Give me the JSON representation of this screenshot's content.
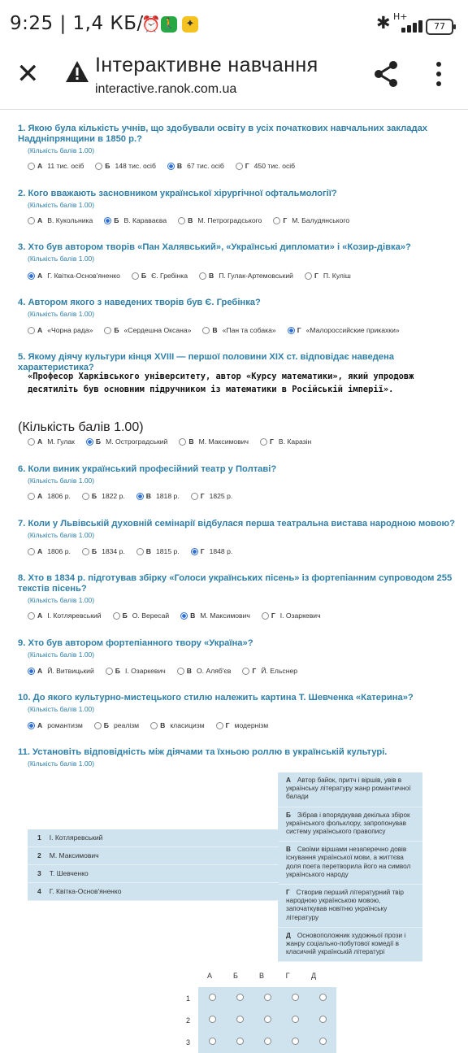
{
  "status": {
    "time": "9:25",
    "speed": "1,4 КБ/с",
    "signal_label": "H+",
    "battery": "77"
  },
  "appbar": {
    "title": "Інтерактивне навчання",
    "url": "interactive.ranok.com.ua"
  },
  "questions": [
    {
      "title": "1. Якою була кількість учнів, що здобували освіту в усіх початкових навчальних закладах Наддніпрянщини в 1850 р.?",
      "score": "(Кількість балів 1.00)",
      "options": [
        {
          "letter": "А",
          "text": "11 тис. осіб",
          "selected": false
        },
        {
          "letter": "Б",
          "text": "148 тис. осіб",
          "selected": false
        },
        {
          "letter": "В",
          "text": "67 тис. осіб",
          "selected": true
        },
        {
          "letter": "Г",
          "text": "450 тис. осіб",
          "selected": false
        }
      ]
    },
    {
      "title": "2. Кого вважають засновником української хірургічної офтальмології?",
      "score": "(Кількість балів 1.00)",
      "options": [
        {
          "letter": "А",
          "text": "В. Кукольника",
          "selected": false
        },
        {
          "letter": "Б",
          "text": "В. Караваєва",
          "selected": true
        },
        {
          "letter": "В",
          "text": "М. Петроградського",
          "selected": false
        },
        {
          "letter": "Г",
          "text": "М. Балудянського",
          "selected": false
        }
      ]
    },
    {
      "title": "3. Хто був автором творів «Пан Халявський», «Українські дипломати» і «Козир-дівка»?",
      "score": "(Кількість балів 1.00)",
      "options": [
        {
          "letter": "А",
          "text": "Г. Квітка-Основ'яненко",
          "selected": true
        },
        {
          "letter": "Б",
          "text": "Є. Гребінка",
          "selected": false
        },
        {
          "letter": "В",
          "text": "П. Гулак-Артемовський",
          "selected": false
        },
        {
          "letter": "Г",
          "text": "П. Куліш",
          "selected": false
        }
      ]
    },
    {
      "title": "4. Автором якого з наведених творів був Є. Гребінка?",
      "score": "(Кількість балів 1.00)",
      "options": [
        {
          "letter": "А",
          "text": "«Чорна рада»",
          "selected": false
        },
        {
          "letter": "Б",
          "text": "«Сердешна Оксана»",
          "selected": false
        },
        {
          "letter": "В",
          "text": "«Пан та собака»",
          "selected": false
        },
        {
          "letter": "Г",
          "text": "«Малороссийские прикахки»",
          "selected": true
        }
      ]
    },
    {
      "title": "5. Якому діячу культури кінця XVIII — першої половини XIX ст. відповідає наведена характеристика?",
      "score": "(Кількість балів 1.00)",
      "quote": "«Професор Харківського університету, автор «Курсу математики», який упродовж десятиліть був основним підручником із математики в Російській імперії».",
      "options": [
        {
          "letter": "А",
          "text": "М. Гулак",
          "selected": false
        },
        {
          "letter": "Б",
          "text": "М. Остроградський",
          "selected": true
        },
        {
          "letter": "В",
          "text": "М. Максимович",
          "selected": false
        },
        {
          "letter": "Г",
          "text": "В. Каразін",
          "selected": false
        }
      ]
    },
    {
      "title": "6. Коли виник український професійний театр у Полтаві?",
      "score": "(Кількість балів 1.00)",
      "options": [
        {
          "letter": "А",
          "text": "1806 р.",
          "selected": false
        },
        {
          "letter": "Б",
          "text": "1822 р.",
          "selected": false
        },
        {
          "letter": "В",
          "text": "1818 р.",
          "selected": true
        },
        {
          "letter": "Г",
          "text": "1825 р.",
          "selected": false
        }
      ]
    },
    {
      "title": "7. Коли у Львівській духовній семінарії відбулася перша театральна вистава народною мовою?",
      "score": "(Кількість балів 1.00)",
      "options": [
        {
          "letter": "А",
          "text": "1806 р.",
          "selected": false
        },
        {
          "letter": "Б",
          "text": "1834 р.",
          "selected": false
        },
        {
          "letter": "В",
          "text": "1815 р.",
          "selected": false
        },
        {
          "letter": "Г",
          "text": "1848 р.",
          "selected": true
        }
      ]
    },
    {
      "title": "8. Хто в 1834 р. підготував збірку «Голоси українських пісень» із фортепіанним супроводом 255 текстів пісень?",
      "score": "(Кількість балів 1.00)",
      "options": [
        {
          "letter": "А",
          "text": "І. Котляревський",
          "selected": false
        },
        {
          "letter": "Б",
          "text": "О. Вересай",
          "selected": false
        },
        {
          "letter": "В",
          "text": "М. Максимович",
          "selected": true
        },
        {
          "letter": "Г",
          "text": "І. Озаркевич",
          "selected": false
        }
      ]
    },
    {
      "title": "9. Хто був автором фортепіанного твору «Україна»?",
      "score": "(Кількість балів 1.00)",
      "options": [
        {
          "letter": "А",
          "text": "Й. Витвицький",
          "selected": true
        },
        {
          "letter": "Б",
          "text": "І. Озаркевич",
          "selected": false
        },
        {
          "letter": "В",
          "text": "О. Аляб'єв",
          "selected": false
        },
        {
          "letter": "Г",
          "text": "Й. Ельснер",
          "selected": false
        }
      ]
    },
    {
      "title": "10. До якого культурно-мистецького стилю належить картина Т. Шевченка «Катерина»?",
      "score": "(Кількість балів 1.00)",
      "options": [
        {
          "letter": "А",
          "text": "романтизм",
          "selected": true
        },
        {
          "letter": "Б",
          "text": "реалізм",
          "selected": false
        },
        {
          "letter": "В",
          "text": "класицизм",
          "selected": false
        },
        {
          "letter": "Г",
          "text": "модернізм",
          "selected": false
        }
      ]
    },
    {
      "title": "11. Установіть відповідність між діячами та їхньою роллю в українській культурі.",
      "score": "(Кількість балів 1.00)"
    }
  ],
  "matching": {
    "left": [
      {
        "num": "1",
        "text": "І. Котляревський"
      },
      {
        "num": "2",
        "text": "М. Максимович"
      },
      {
        "num": "3",
        "text": "Т. Шевченко"
      },
      {
        "num": "4",
        "text": "Г. Квітка-Основ'яненко"
      }
    ],
    "right": [
      {
        "letter": "А",
        "text": "Автор байок, притч і віршів, увів в українську літературу жанр романтичної балади"
      },
      {
        "letter": "Б",
        "text": "Зібрав і впорядкував декілька збірок українського фольклору, запропонував систему українського правопису"
      },
      {
        "letter": "В",
        "text": "Своїми віршами незаперечно довів існування української мови, а життєва доля поета перетворила його на символ українського народу"
      },
      {
        "letter": "Г",
        "text": "Створив перший літературний твір народною українською мовою, започаткував новітню українську літературу"
      },
      {
        "letter": "Д",
        "text": "Основоположник художньої прози і жанру соціально-побутової комедії в класичній українській літературі"
      }
    ],
    "grid_cols": [
      "А",
      "Б",
      "В",
      "Г",
      "Д"
    ],
    "grid_rows": [
      "1",
      "2",
      "3"
    ]
  }
}
